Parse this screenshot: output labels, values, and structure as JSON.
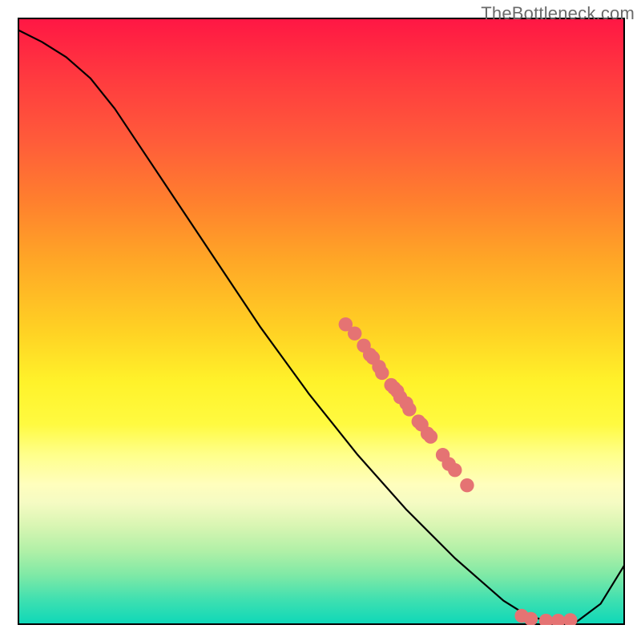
{
  "watermark": "TheBottleneck.com",
  "chart_data": {
    "type": "line",
    "title": "",
    "xlabel": "",
    "ylabel": "",
    "xlim": [
      0,
      100
    ],
    "ylim": [
      0,
      100
    ],
    "background_gradient_stops": [
      {
        "pos": 0,
        "color": "#ff1744"
      },
      {
        "pos": 10,
        "color": "#ff3b3f"
      },
      {
        "pos": 20,
        "color": "#ff5b3a"
      },
      {
        "pos": 30,
        "color": "#ff7f2e"
      },
      {
        "pos": 40,
        "color": "#ffa726"
      },
      {
        "pos": 52,
        "color": "#ffd324"
      },
      {
        "pos": 60,
        "color": "#fff22a"
      },
      {
        "pos": 67,
        "color": "#fffa40"
      },
      {
        "pos": 72,
        "color": "#ffff8a"
      },
      {
        "pos": 77,
        "color": "#fffebd"
      },
      {
        "pos": 80,
        "color": "#f5fbc3"
      },
      {
        "pos": 84,
        "color": "#d7f5b2"
      },
      {
        "pos": 88,
        "color": "#b1f0a7"
      },
      {
        "pos": 92,
        "color": "#7fe9a6"
      },
      {
        "pos": 96,
        "color": "#40e0b0"
      },
      {
        "pos": 100,
        "color": "#0fd8b8"
      }
    ],
    "series": [
      {
        "name": "bottleneck-curve",
        "x": [
          0,
          4,
          8,
          12,
          16,
          20,
          24,
          28,
          32,
          36,
          40,
          44,
          48,
          52,
          56,
          60,
          64,
          68,
          72,
          76,
          80,
          84,
          88,
          92,
          96,
          100
        ],
        "y": [
          98,
          96,
          93.5,
          90,
          85,
          79,
          73,
          67,
          61,
          55,
          49,
          43.5,
          38,
          33,
          28,
          23.5,
          19,
          15,
          11,
          7.5,
          4,
          1.5,
          0.5,
          0.5,
          3.5,
          10
        ]
      }
    ],
    "scatter": {
      "name": "marker-points",
      "color": "#e57373",
      "points": [
        {
          "x": 54,
          "y": 49.5
        },
        {
          "x": 55.5,
          "y": 48
        },
        {
          "x": 57,
          "y": 46
        },
        {
          "x": 58,
          "y": 44.5
        },
        {
          "x": 58.5,
          "y": 44
        },
        {
          "x": 59.5,
          "y": 42.5
        },
        {
          "x": 60,
          "y": 41.5
        },
        {
          "x": 61.5,
          "y": 39.5
        },
        {
          "x": 62,
          "y": 39
        },
        {
          "x": 62.5,
          "y": 38.5
        },
        {
          "x": 63,
          "y": 37.5
        },
        {
          "x": 64,
          "y": 36.5
        },
        {
          "x": 64.5,
          "y": 35.5
        },
        {
          "x": 66,
          "y": 33.5
        },
        {
          "x": 66.5,
          "y": 33
        },
        {
          "x": 67.5,
          "y": 31.5
        },
        {
          "x": 68,
          "y": 31
        },
        {
          "x": 70,
          "y": 28
        },
        {
          "x": 71,
          "y": 26.5
        },
        {
          "x": 72,
          "y": 25.5
        },
        {
          "x": 74,
          "y": 23
        },
        {
          "x": 83,
          "y": 1.5
        },
        {
          "x": 84.5,
          "y": 1
        },
        {
          "x": 87,
          "y": 0.7
        },
        {
          "x": 89,
          "y": 0.7
        },
        {
          "x": 91,
          "y": 0.8
        }
      ]
    }
  }
}
